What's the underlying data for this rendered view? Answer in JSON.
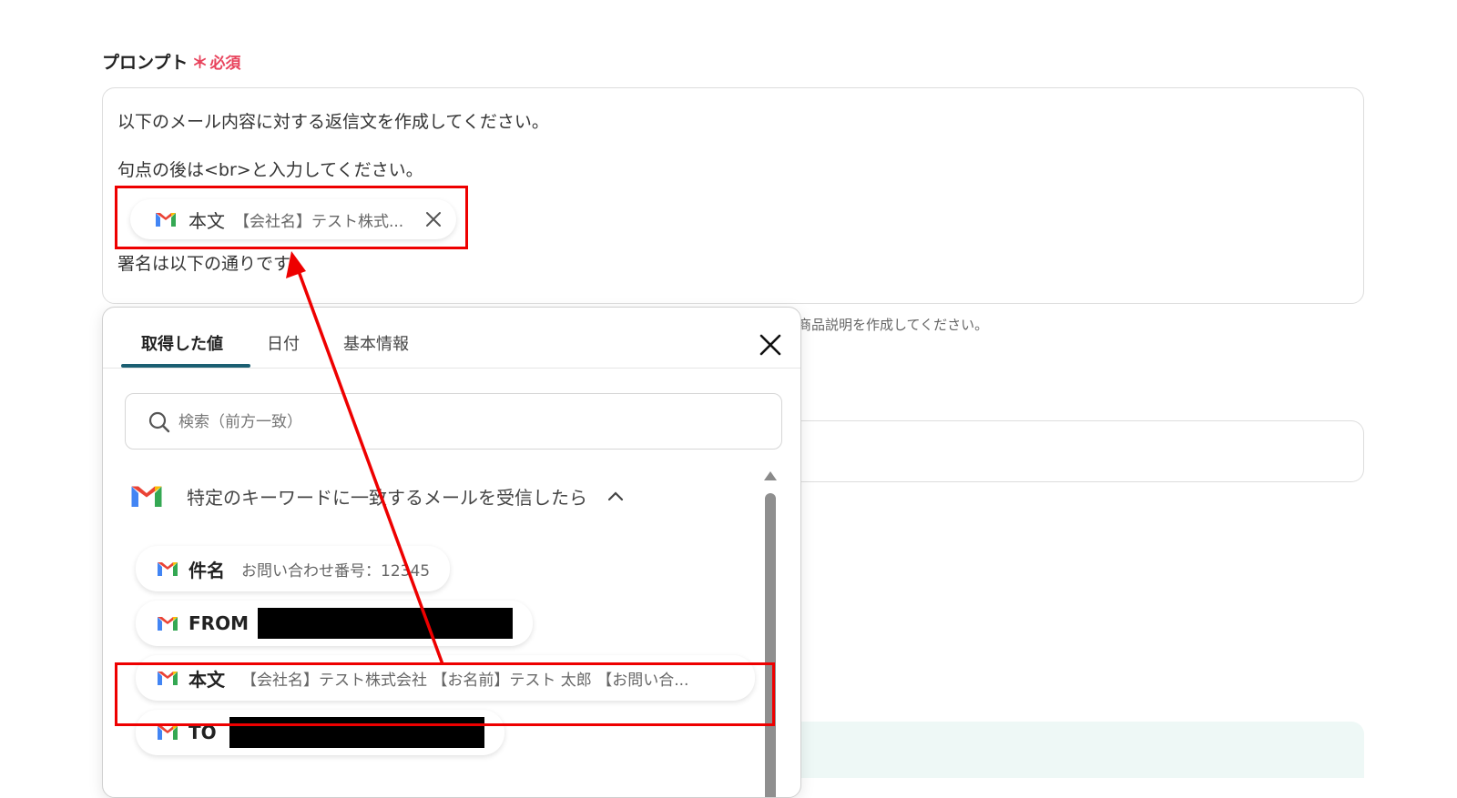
{
  "field": {
    "label": "プロンプト",
    "required_mark": "＊",
    "required_text": "必須"
  },
  "prompt": {
    "line1": "以下のメール内容に対する返信文を作成してください。",
    "line2": "句点の後は<br>と入力してください。",
    "chip": {
      "key": "本文",
      "value": "【会社名】テスト株式...",
      "icon": "gmail-icon",
      "close_icon": "close-icon"
    },
    "line4": "署名は以下の通りです。"
  },
  "helper_text": "商品説明を作成してください。",
  "picker": {
    "tabs": [
      "取得した値",
      "日付",
      "基本情報"
    ],
    "active_tab": "取得した値",
    "close_icon": "close-icon",
    "search": {
      "placeholder": "検索（前方一致）",
      "value": "",
      "icon": "search-icon"
    },
    "section": {
      "title": "特定のキーワードに一致するメールを受信したら",
      "icon": "gmail-icon",
      "toggle_icon": "chevron-up-icon"
    },
    "items": [
      {
        "key": "件名",
        "value": "お問い合わせ番号：12345",
        "redacted": false
      },
      {
        "key": "FROM",
        "value": "",
        "redacted": true
      },
      {
        "key": "本文",
        "value": "【会社名】テスト株式会社 【お名前】テスト 太郎 【お問い合...",
        "redacted": false
      },
      {
        "key": "TO",
        "value": "",
        "redacted": true
      }
    ]
  },
  "annotation": {
    "color": "#ee0000"
  },
  "colors": {
    "required": "#e8435c",
    "tab_underline": "#1b5f72",
    "gmail_red": "#ea4335",
    "gmail_blue": "#4285f4",
    "gmail_green": "#34a853",
    "gmail_yellow": "#fbbc04"
  }
}
